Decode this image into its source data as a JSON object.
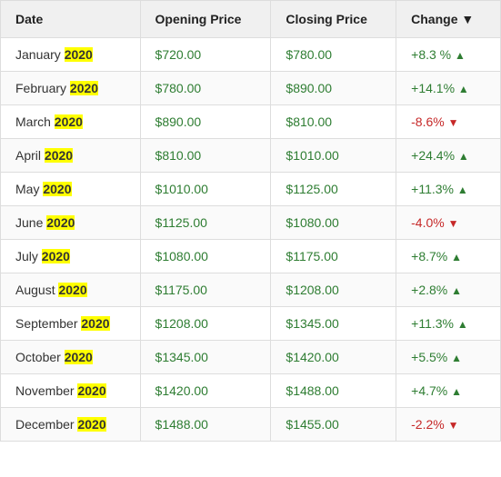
{
  "table": {
    "headers": [
      {
        "label": "Date",
        "key": "date"
      },
      {
        "label": "Opening Price",
        "key": "opening"
      },
      {
        "label": "Closing Price",
        "key": "closing"
      },
      {
        "label": "Change ▼",
        "key": "change"
      }
    ],
    "rows": [
      {
        "month": "January",
        "year": "2020",
        "opening": "$720.00",
        "closing": "$780.00",
        "change": "+8.3 %",
        "direction": "up"
      },
      {
        "month": "February",
        "year": "2020",
        "opening": "$780.00",
        "closing": "$890.00",
        "change": "+14.1%",
        "direction": "up"
      },
      {
        "month": "March",
        "year": "2020",
        "opening": "$890.00",
        "closing": "$810.00",
        "change": "-8.6%",
        "direction": "down"
      },
      {
        "month": "April",
        "year": "2020",
        "opening": "$810.00",
        "closing": "$1010.00",
        "change": "+24.4%",
        "direction": "up"
      },
      {
        "month": "May",
        "year": "2020",
        "opening": "$1010.00",
        "closing": "$1125.00",
        "change": "+11.3%",
        "direction": "up"
      },
      {
        "month": "June",
        "year": "2020",
        "opening": "$1125.00",
        "closing": "$1080.00",
        "change": "-4.0%",
        "direction": "down"
      },
      {
        "month": "July",
        "year": "2020",
        "opening": "$1080.00",
        "closing": "$1175.00",
        "change": "+8.7%",
        "direction": "up"
      },
      {
        "month": "August",
        "year": "2020",
        "opening": "$1175.00",
        "closing": "$1208.00",
        "change": "+2.8%",
        "direction": "up"
      },
      {
        "month": "September",
        "year": "2020",
        "opening": "$1208.00",
        "closing": "$1345.00",
        "change": "+11.3%",
        "direction": "up"
      },
      {
        "month": "October",
        "year": "2020",
        "opening": "$1345.00",
        "closing": "$1420.00",
        "change": "+5.5%",
        "direction": "up"
      },
      {
        "month": "November",
        "year": "2020",
        "opening": "$1420.00",
        "closing": "$1488.00",
        "change": "+4.7%",
        "direction": "up"
      },
      {
        "month": "December",
        "year": "2020",
        "opening": "$1488.00",
        "closing": "$1455.00",
        "change": "-2.2%",
        "direction": "down"
      }
    ]
  }
}
